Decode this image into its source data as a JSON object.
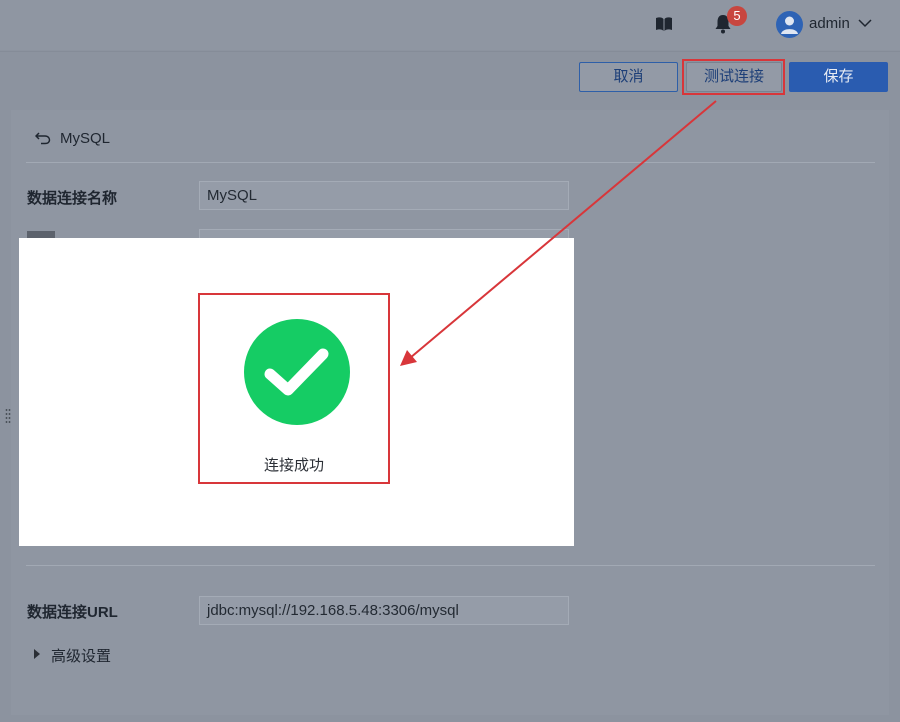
{
  "header": {
    "notification_count": "5",
    "username": "admin",
    "icons": {
      "docs": "book-icon",
      "notifications": "bell-icon",
      "avatar": "user-icon",
      "menu": "chevron-down-icon"
    }
  },
  "toolbar": {
    "cancel_label": "取消",
    "test_label": "测试连接",
    "save_label": "保存"
  },
  "form": {
    "back_label": "MySQL",
    "name_label": "数据连接名称",
    "name_value": "MySQL",
    "url_label": "数据连接URL",
    "url_value": "jdbc:mysql://192.168.5.48:3306/mysql",
    "advanced_label": "高级设置"
  },
  "dialog": {
    "message": "连接成功",
    "icon": "check-circle-icon"
  },
  "colors": {
    "accent": "#2a5cb0",
    "success": "#15cc64",
    "highlight": "#d8363a",
    "badge": "#c8463f"
  }
}
